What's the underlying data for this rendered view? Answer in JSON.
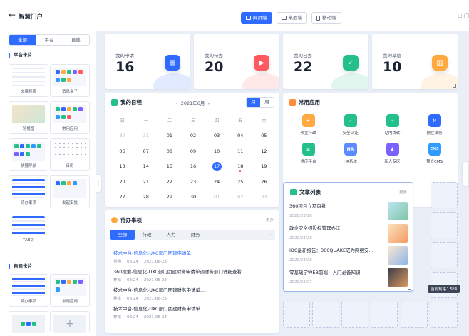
{
  "header": {
    "app_title": "智慧门户",
    "modes": [
      {
        "label": "网页端",
        "active": true
      },
      {
        "label": "桌面端",
        "active": false
      },
      {
        "label": "移动端",
        "active": false
      }
    ],
    "right_text": "门"
  },
  "left_panel": {
    "tabs": [
      "全部",
      "平台",
      "自建"
    ],
    "platform_section": "平台卡片",
    "platform_cards": [
      "文章列表",
      "消息盒子",
      "轮播图",
      "常用应用",
      "快捷导航",
      "日历",
      "待办事项",
      "发起审批",
      "TAB页"
    ],
    "custom_section": "自建卡片",
    "custom_cards": [
      "待办事项",
      "常用应用"
    ],
    "add_icon": "+"
  },
  "stats": [
    {
      "label": "我的申请",
      "value": "16",
      "icon": "doc-icon",
      "color": "#2f6bff"
    },
    {
      "label": "我的待办",
      "value": "20",
      "icon": "play-icon",
      "color": "#ff5a5f"
    },
    {
      "label": "我的已办",
      "value": "22",
      "icon": "check-icon",
      "color": "#23c08a"
    },
    {
      "label": "我的草稿",
      "value": "10",
      "icon": "draft-icon",
      "color": "#ffa940"
    }
  ],
  "calendar": {
    "title": "我的日程",
    "month": "2021年6月",
    "toggle": [
      "月",
      "周"
    ],
    "weekdays": [
      "日",
      "一",
      "二",
      "三",
      "四",
      "五",
      "六"
    ],
    "weeks": [
      [
        "30",
        "31",
        "01",
        "02",
        "03",
        "04",
        "05"
      ],
      [
        "06",
        "07",
        "08",
        "09",
        "10",
        "11",
        "12"
      ],
      [
        "13",
        "14",
        "15",
        "16",
        "17",
        "18",
        "19"
      ],
      [
        "20",
        "21",
        "22",
        "23",
        "24",
        "25",
        "26"
      ],
      [
        "27",
        "28",
        "29",
        "30",
        "01",
        "02",
        "03"
      ]
    ],
    "today": "17"
  },
  "apps": {
    "title": "常用应用",
    "items": [
      {
        "label": "预立行政",
        "color": "#ffa940",
        "glyph": "★"
      },
      {
        "label": "安全认证",
        "color": "#23c08a",
        "glyph": "✓"
      },
      {
        "label": "站内跳转",
        "color": "#23c08a",
        "glyph": "➜"
      },
      {
        "label": "预立法务",
        "color": "#2f6bff",
        "glyph": "⚒"
      },
      {
        "label": "供应平台",
        "color": "#23c08a",
        "glyph": "≡"
      },
      {
        "label": "HR系统",
        "color": "#5b8cff",
        "glyph": "HR"
      },
      {
        "label": "新人专区",
        "color": "#7b61ff",
        "glyph": "♟"
      },
      {
        "label": "预立CMS",
        "color": "#2f9bff",
        "glyph": "CMS"
      }
    ]
  },
  "articles": {
    "title": "文章列表",
    "more": "更多",
    "items": [
      {
        "title": "360项目立项审批",
        "date": "2020/03/28"
      },
      {
        "title": "政企安全招投标管理办法",
        "date": "2020/03/28"
      },
      {
        "title": "IDC最新报告：360QUAKE成为网络安...",
        "date": "2020/03/28"
      },
      {
        "title": "零基础学WEB前端：入门必备知识",
        "date": "2020/03/27"
      }
    ],
    "size_tip": "当前规格：5*4"
  },
  "todo": {
    "title": "待办事项",
    "more": "更多",
    "tabs": [
      "全部",
      "行政",
      "人力",
      "财务"
    ],
    "items": [
      {
        "title": "技术中台-信息化-UXC部门团建申请单",
        "user": "刘畅",
        "time": "08:24",
        "date": "2021-06-23"
      },
      {
        "title": "360搜索-信息化-UXC部门团建财务申请单调财务部门详细查看...",
        "user": "林松",
        "time": "08:24",
        "date": "2021-06-23"
      },
      {
        "title": "技术中台-信息化-UXC部门团建财务申请单...",
        "user": "林松",
        "time": "08:24",
        "date": "2021-06-23"
      },
      {
        "title": "技术中台-信息化-UXC部门团建财务申请单...",
        "user": "林松",
        "time": "08:24",
        "date": "2021-06-23"
      }
    ]
  }
}
